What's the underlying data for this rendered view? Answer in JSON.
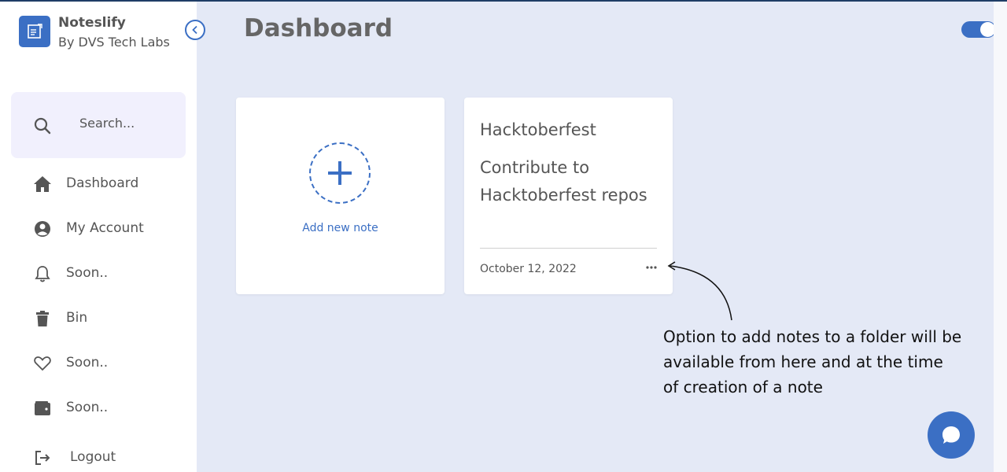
{
  "brand": {
    "name": "Noteslify",
    "subtitle": "By DVS Tech Labs"
  },
  "search": {
    "placeholder": "Search..."
  },
  "nav": [
    {
      "label": "Dashboard",
      "icon": "home-icon"
    },
    {
      "label": "My Account",
      "icon": "account-circle-icon"
    },
    {
      "label": "Soon..",
      "icon": "bell-icon"
    },
    {
      "label": "Bin",
      "icon": "trash-icon"
    },
    {
      "label": "Soon..",
      "icon": "heart-icon"
    },
    {
      "label": "Soon..",
      "icon": "wallet-icon"
    },
    {
      "label": "Logout",
      "icon": "logout-icon"
    }
  ],
  "main": {
    "title": "Dashboard"
  },
  "add_card": {
    "label": "Add new note"
  },
  "note": {
    "title": "Hacktoberfest",
    "body": "Contribute to Hacktoberfest repos",
    "date": "October 12, 2022"
  },
  "annotation": "Option to add notes to a folder will be available from here and at the time of creation of a note",
  "theme_toggle": {
    "on": true
  },
  "colors": {
    "accent": "#3b6fc4",
    "background": "#e4e9f6",
    "sidebar": "#ffffff"
  }
}
